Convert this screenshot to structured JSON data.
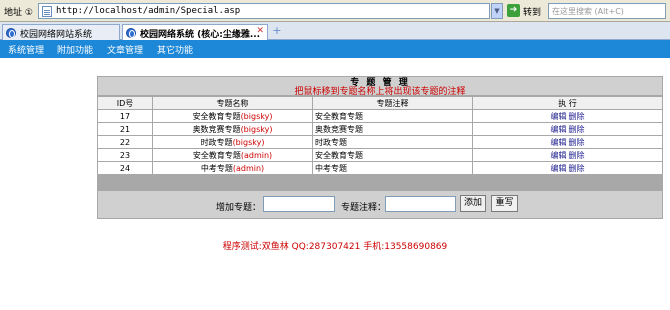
{
  "browser": {
    "address_label": "地址 ①",
    "url": "http://localhost/admin/Special.asp",
    "go_label": "转到",
    "search_placeholder": "在这里搜索 (Alt+C)"
  },
  "tabs": [
    {
      "title": "校园网络网站系统",
      "active": false
    },
    {
      "title": "校园网络系统 (核心:尘缘雅...",
      "active": true
    }
  ],
  "nav": [
    "系统管理",
    "附加功能",
    "文章管理",
    "其它功能"
  ],
  "panel": {
    "title": "专 题 管 理",
    "hint": "把鼠标移到专题名称上将出现该专题的注释",
    "columns": [
      "ID号",
      "专题名称",
      "专题注释",
      "执   行"
    ],
    "rows": [
      {
        "id": "17",
        "name": "安全教育专题",
        "author": "(bigsky)",
        "note": "安全教育专题",
        "edit": "编辑",
        "delete": "删除"
      },
      {
        "id": "21",
        "name": "奥数竞赛专题",
        "author": "(bigsky)",
        "note": "奥数竞赛专题",
        "edit": "编辑",
        "delete": "删除"
      },
      {
        "id": "22",
        "name": "时政专题",
        "author": "(bigsky)",
        "note": "时政专题",
        "edit": "编辑",
        "delete": "删除"
      },
      {
        "id": "23",
        "name": "安全教育专题",
        "author": "(admin)",
        "note": "安全教育专题",
        "edit": "编辑",
        "delete": "删除"
      },
      {
        "id": "24",
        "name": "中考专题",
        "author": "(admin)",
        "note": "中考专题",
        "edit": "编辑",
        "delete": "删除"
      }
    ],
    "form": {
      "add_label": "增加专题：",
      "add_value": "",
      "note_label": "专题注释：",
      "note_value": "",
      "add_button": "添加",
      "reset_button": "重写"
    }
  },
  "credits": "程序测试:双鱼林 QQ:287307421 手机:13558690869"
}
